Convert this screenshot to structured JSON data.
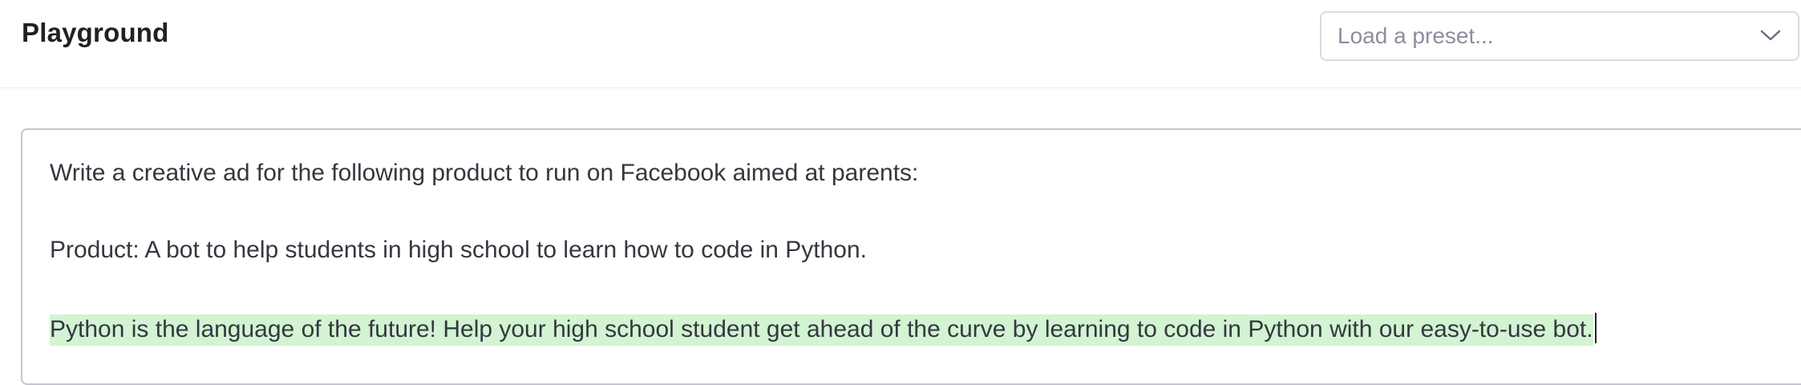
{
  "header": {
    "title": "Playground",
    "preset_placeholder": "Load a preset..."
  },
  "editor": {
    "prompt_line": "Write a creative ad for the following product to run on Facebook aimed at parents:",
    "product_line": "Product: A bot to help students in high school to learn how to code in Python.",
    "completion_line": "Python is the language of the future! Help your high school student get ahead of the curve by learning to code in Python with our easy-to-use bot."
  },
  "colors": {
    "completion_highlight": "#d2f4d3",
    "border": "#c5c5d2",
    "placeholder": "#8e8ea0"
  },
  "icons": {
    "preset_dropdown": "chevron-down-icon"
  }
}
